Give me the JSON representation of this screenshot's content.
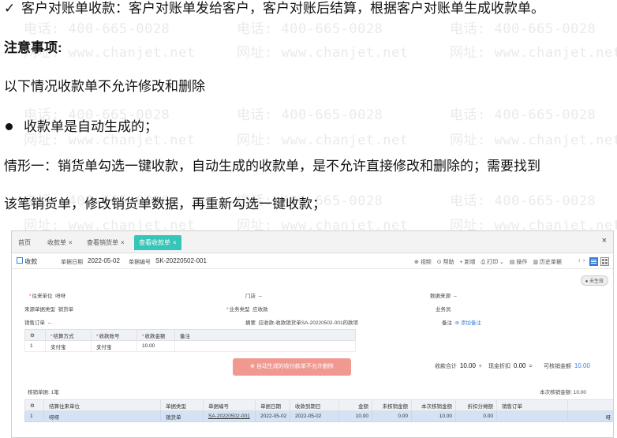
{
  "watermark": {
    "phone": "电话: 400-665-0028",
    "site": "网址: www.chanjet.net"
  },
  "doc": {
    "line1_mark": "✓",
    "line1": "客户对账单收款：客户对账单发给客户，客户对账后结算，根据客户对账单生成收款单。",
    "heading": "注意事项:",
    "line3": "以下情况收款单不允许修改和删除",
    "bullet1": "收款单是自动生成的；",
    "line5": "情形一：销货单勾选一键收款，自动生成的收款单，是不允许直接修改和删除的；需要找到",
    "line6": "该笔销货单，修改销货单数据，再重新勾选一键收款；"
  },
  "app": {
    "tabs": [
      {
        "label": "首页",
        "close": ""
      },
      {
        "label": "收款单",
        "close": "×"
      },
      {
        "label": "查看销货单",
        "close": "×"
      },
      {
        "label": "查看收款单",
        "close": "×"
      }
    ],
    "window_close": "×",
    "toolbar": {
      "title": "收款",
      "date_label": "单据日期",
      "date_value": "2022-05-02",
      "code_label": "单据编号",
      "code_value": "SK-20220502-001",
      "video": "视频",
      "help": "帮助",
      "add": "新增",
      "print": "打印",
      "operate": "操作",
      "history": "历史单据"
    },
    "status_pill": "未生效",
    "fields": {
      "partner_label": "往来单位",
      "partner_value": "呀呀",
      "store_label": "门店",
      "store_value": "--",
      "source_label": "数据来源",
      "source_value": "--",
      "src_type_label": "来源单据类型",
      "src_type_value": "销货单",
      "biz_type_label": "业务类型",
      "biz_type_value": "应收款",
      "salesman_label": "业务员",
      "order_label": "销售订单",
      "order_value": "--",
      "summary_label": "摘要",
      "summary_value": "应收款-收款销货单SA-20220502-001的款项",
      "remark_label": "备注",
      "remark_link": "添加备注"
    },
    "settle_grid": {
      "headers": [
        "结算方式",
        "收款账号",
        "收款金额",
        "备注"
      ],
      "rows": [
        {
          "index": "1",
          "method": "支付宝",
          "account": "支付宝",
          "amount": "10.00",
          "note": ""
        }
      ]
    },
    "toast": "自动生成的收付款单不允许删除",
    "totals": {
      "receipt_label": "收款合计",
      "receipt_value": "10.00",
      "discount_label": "现金折扣",
      "discount_value": "0.00",
      "writeoff_label": "可核销金额",
      "writeoff_value": "10.00"
    },
    "writeoff_count": "核销单据: 1笔",
    "writeoff_this": "本次核销金额: 10.00",
    "writeoff_grid": {
      "headers": [
        "结算往来单位",
        "单据类型",
        "单据编号",
        "单据日期",
        "收款到期日",
        "金额",
        "未核销金额",
        "本次核销金额",
        "折扣分摊额",
        "销售订单"
      ],
      "rows": [
        {
          "index": "1",
          "partner": "呀呀",
          "type": "销货单",
          "code": "SA-20220502-001",
          "date": "2022-05-02",
          "due": "2022-05-02",
          "amount": "10.00",
          "unwritten": "0.00",
          "this": "10.00",
          "disc": "0.00",
          "order": ""
        }
      ]
    },
    "row_tail": "呀"
  }
}
